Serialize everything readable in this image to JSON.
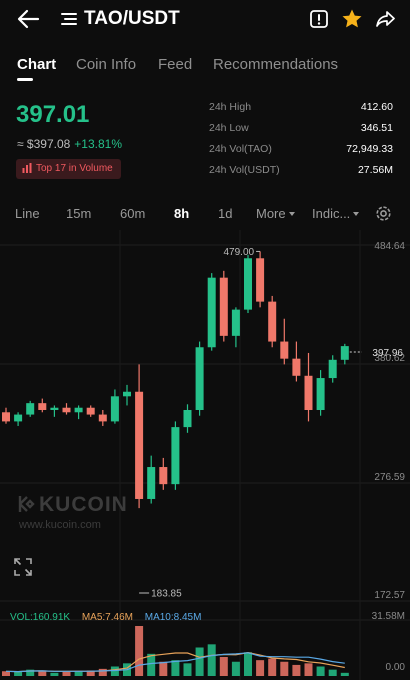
{
  "header": {
    "pair": "TAO/USDT",
    "icons": [
      "back-arrow-icon",
      "menu-icon",
      "alert-icon",
      "star-icon",
      "share-icon"
    ]
  },
  "tabs": [
    {
      "label": "Chart",
      "active": true
    },
    {
      "label": "Coin Info",
      "active": false
    },
    {
      "label": "Feed",
      "active": false
    },
    {
      "label": "Recommendations",
      "active": false
    }
  ],
  "ticker": {
    "last_price": "397.01",
    "fiat_price": "≈ $397.08",
    "change": "+13.81%",
    "badge": "Top 17 in Volume"
  },
  "stats": {
    "high_label": "24h High",
    "high_value": "412.60",
    "low_label": "24h Low",
    "low_value": "346.51",
    "vol_base_label": "24h Vol(TAO)",
    "vol_base_value": "72,949.33",
    "vol_quote_label": "24h Vol(USDT)",
    "vol_quote_value": "27.56M"
  },
  "timeframes": {
    "line": "Line",
    "m15": "15m",
    "m60": "60m",
    "h8": "8h",
    "d1": "1d",
    "more": "More",
    "indicators": "Indic...",
    "active": "8h"
  },
  "watermark": {
    "logo": "KUCOIN",
    "url": "www.kucoin.com"
  },
  "volume_legend": {
    "vol": "VOL:160.91K",
    "ma5": "MA5:7.46M",
    "ma10": "MA10:8.45M"
  },
  "colors": {
    "up": "#25c18a",
    "down": "#f0786a",
    "ma5": "#e8a35a",
    "ma10": "#5aa9e6",
    "background": "#0d0d0d"
  },
  "chart_data": {
    "type": "candlestick",
    "price_axis_labels": [
      "484.64",
      "380.62",
      "276.59",
      "172.57"
    ],
    "current_price_label": "397.96",
    "max_marker": "479.00",
    "min_marker": "183.85",
    "volume_axis_labels": [
      "31.58M",
      "0.00"
    ],
    "ylim": [
      172.57,
      484.64
    ],
    "candles": [
      [
        338,
        342,
        328,
        330
      ],
      [
        330,
        338,
        326,
        336
      ],
      [
        336,
        348,
        334,
        346
      ],
      [
        346,
        350,
        338,
        340
      ],
      [
        340,
        344,
        334,
        342
      ],
      [
        342,
        346,
        336,
        338
      ],
      [
        338,
        344,
        332,
        342
      ],
      [
        342,
        344,
        334,
        336
      ],
      [
        336,
        340,
        326,
        330
      ],
      [
        330,
        358,
        328,
        352
      ],
      [
        352,
        362,
        344,
        356
      ],
      [
        356,
        380,
        254,
        262
      ],
      [
        262,
        300,
        258,
        290
      ],
      [
        290,
        298,
        270,
        275
      ],
      [
        275,
        330,
        270,
        325
      ],
      [
        325,
        345,
        320,
        340
      ],
      [
        340,
        400,
        335,
        395
      ],
      [
        395,
        460,
        392,
        456
      ],
      [
        456,
        462,
        400,
        405
      ],
      [
        405,
        430,
        395,
        428
      ],
      [
        428,
        476,
        425,
        473
      ],
      [
        473,
        479,
        430,
        435
      ],
      [
        435,
        440,
        395,
        400
      ],
      [
        400,
        420,
        380,
        385
      ],
      [
        385,
        400,
        365,
        370
      ],
      [
        370,
        390,
        330,
        340
      ],
      [
        340,
        375,
        335,
        368
      ],
      [
        368,
        388,
        364,
        384
      ],
      [
        384,
        398,
        380,
        396
      ]
    ],
    "volume": [
      3,
      2.5,
      4,
      3.5,
      2,
      3,
      2.8,
      3.5,
      4.5,
      6,
      8,
      31.58,
      14,
      9,
      10,
      8,
      18,
      20,
      12,
      9,
      15,
      10,
      11,
      9,
      7,
      8,
      6,
      4,
      2
    ],
    "volume_up": [
      0,
      1,
      1,
      0,
      1,
      0,
      1,
      0,
      0,
      1,
      1,
      0,
      1,
      0,
      1,
      1,
      1,
      1,
      0,
      1,
      1,
      0,
      0,
      0,
      0,
      0,
      1,
      1,
      1
    ]
  }
}
